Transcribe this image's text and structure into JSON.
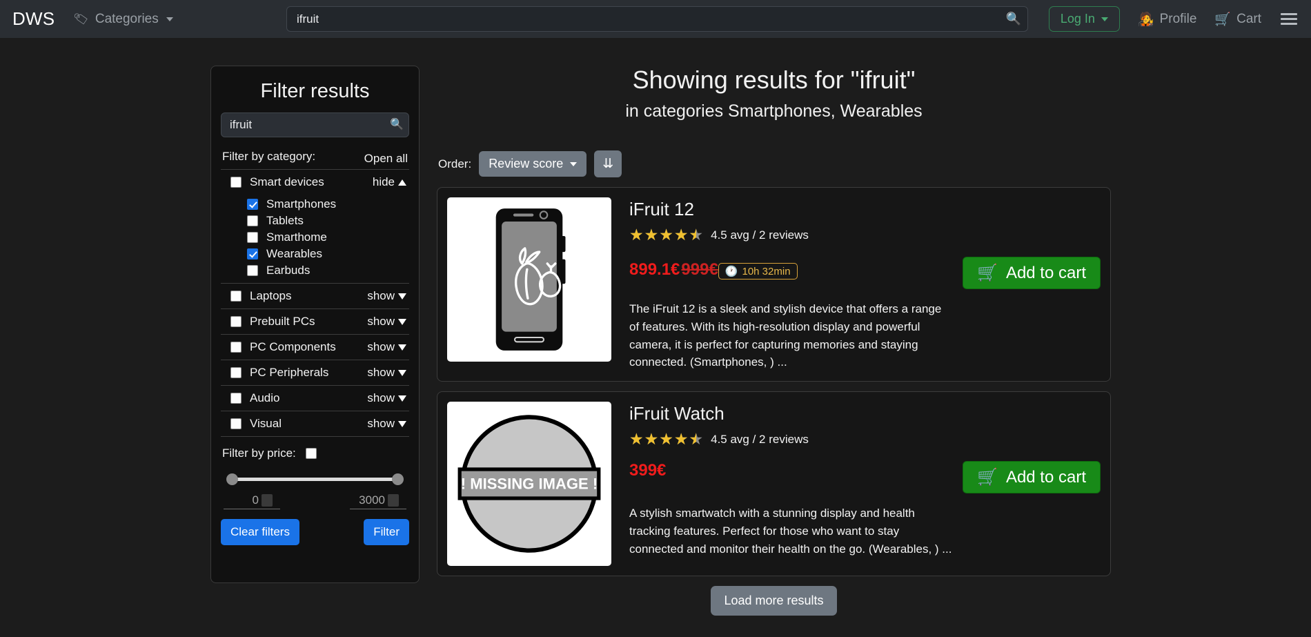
{
  "navbar": {
    "brand": "DWS",
    "categories_label": "Categories",
    "categories_icon": "tag-icon",
    "search_value": "ifruit",
    "search_placeholder": "",
    "search_icon": "search-icon",
    "login_label": "Log In",
    "profile_label": "Profile",
    "profile_icon": "profile-avatar-icon",
    "cart_label": "Cart",
    "cart_icon": "shopping-cart-icon",
    "menu_icon": "hamburger-menu-icon"
  },
  "sidebar": {
    "title": "Filter results",
    "search_value": "ifruit",
    "search_icon": "search-icon",
    "filter_by_category_label": "Filter by category:",
    "open_all_label": "Open all",
    "groups": [
      {
        "label": "Smart devices",
        "checked": false,
        "expanded": true,
        "toggle_label": "hide",
        "subcategories": [
          {
            "label": "Smartphones",
            "checked": true
          },
          {
            "label": "Tablets",
            "checked": false
          },
          {
            "label": "Smarthome",
            "checked": false
          },
          {
            "label": "Wearables",
            "checked": true
          },
          {
            "label": "Earbuds",
            "checked": false
          }
        ]
      },
      {
        "label": "Laptops",
        "checked": false,
        "expanded": false,
        "toggle_label": "show",
        "subcategories": []
      },
      {
        "label": "Prebuilt PCs",
        "checked": false,
        "expanded": false,
        "toggle_label": "show",
        "subcategories": []
      },
      {
        "label": "PC Components",
        "checked": false,
        "expanded": false,
        "toggle_label": "show",
        "subcategories": []
      },
      {
        "label": "PC Peripherals",
        "checked": false,
        "expanded": false,
        "toggle_label": "show",
        "subcategories": []
      },
      {
        "label": "Audio",
        "checked": false,
        "expanded": false,
        "toggle_label": "show",
        "subcategories": []
      },
      {
        "label": "Visual",
        "checked": false,
        "expanded": false,
        "toggle_label": "show",
        "subcategories": []
      }
    ],
    "filter_by_price_label": "Filter by price:",
    "price_enabled": false,
    "price_min": "0",
    "price_max": "3000",
    "clear_filters_label": "Clear filters",
    "filter_label": "Filter"
  },
  "results": {
    "title": "Showing results for \"ifruit\"",
    "subtitle": "in categories Smartphones, Wearables",
    "order_label": "Order:",
    "order_value": "Review score",
    "sort_direction_icon": "sort-descending-icon",
    "sort_direction_glyph": "⇊",
    "load_more_label": "Load more results",
    "products": [
      {
        "name": "iFruit 12",
        "image_kind": "smartphone-illustration",
        "rating": 4.5,
        "rating_text": "4.5 avg / 2 reviews",
        "price": "899.1€",
        "old_price": "999€",
        "countdown": "10h 32min",
        "countdown_icon": "clock-icon",
        "add_to_cart_label": "Add to cart",
        "cart_icon": "shopping-cart-icon",
        "description": "The iFruit 12 is a sleek and stylish device that offers a range of features. With its high-resolution display and powerful camera, it is perfect for capturing memories and staying connected. (Smartphones, ) ..."
      },
      {
        "name": "iFruit Watch",
        "image_kind": "missing-image-placeholder",
        "image_placeholder_text": "!  MISSING IMAGE  !",
        "rating": 4.5,
        "rating_text": "4.5 avg / 2 reviews",
        "price": "399€",
        "old_price": "",
        "countdown": "",
        "add_to_cart_label": "Add to cart",
        "cart_icon": "shopping-cart-icon",
        "description": "A stylish smartwatch with a stunning display and health tracking features. Perfect for those who want to stay connected and monitor their health on the go. (Wearables, ) ..."
      }
    ]
  },
  "colors": {
    "navbar_bg": "#2a2e33",
    "page_bg": "#1c1c1c",
    "accent_blue": "#1a73e8",
    "cart_green": "#188a18",
    "price_red": "#f01c1c",
    "star_gold": "#f0c030",
    "countdown_orange": "#e8b84b",
    "login_green": "#4aab73"
  }
}
